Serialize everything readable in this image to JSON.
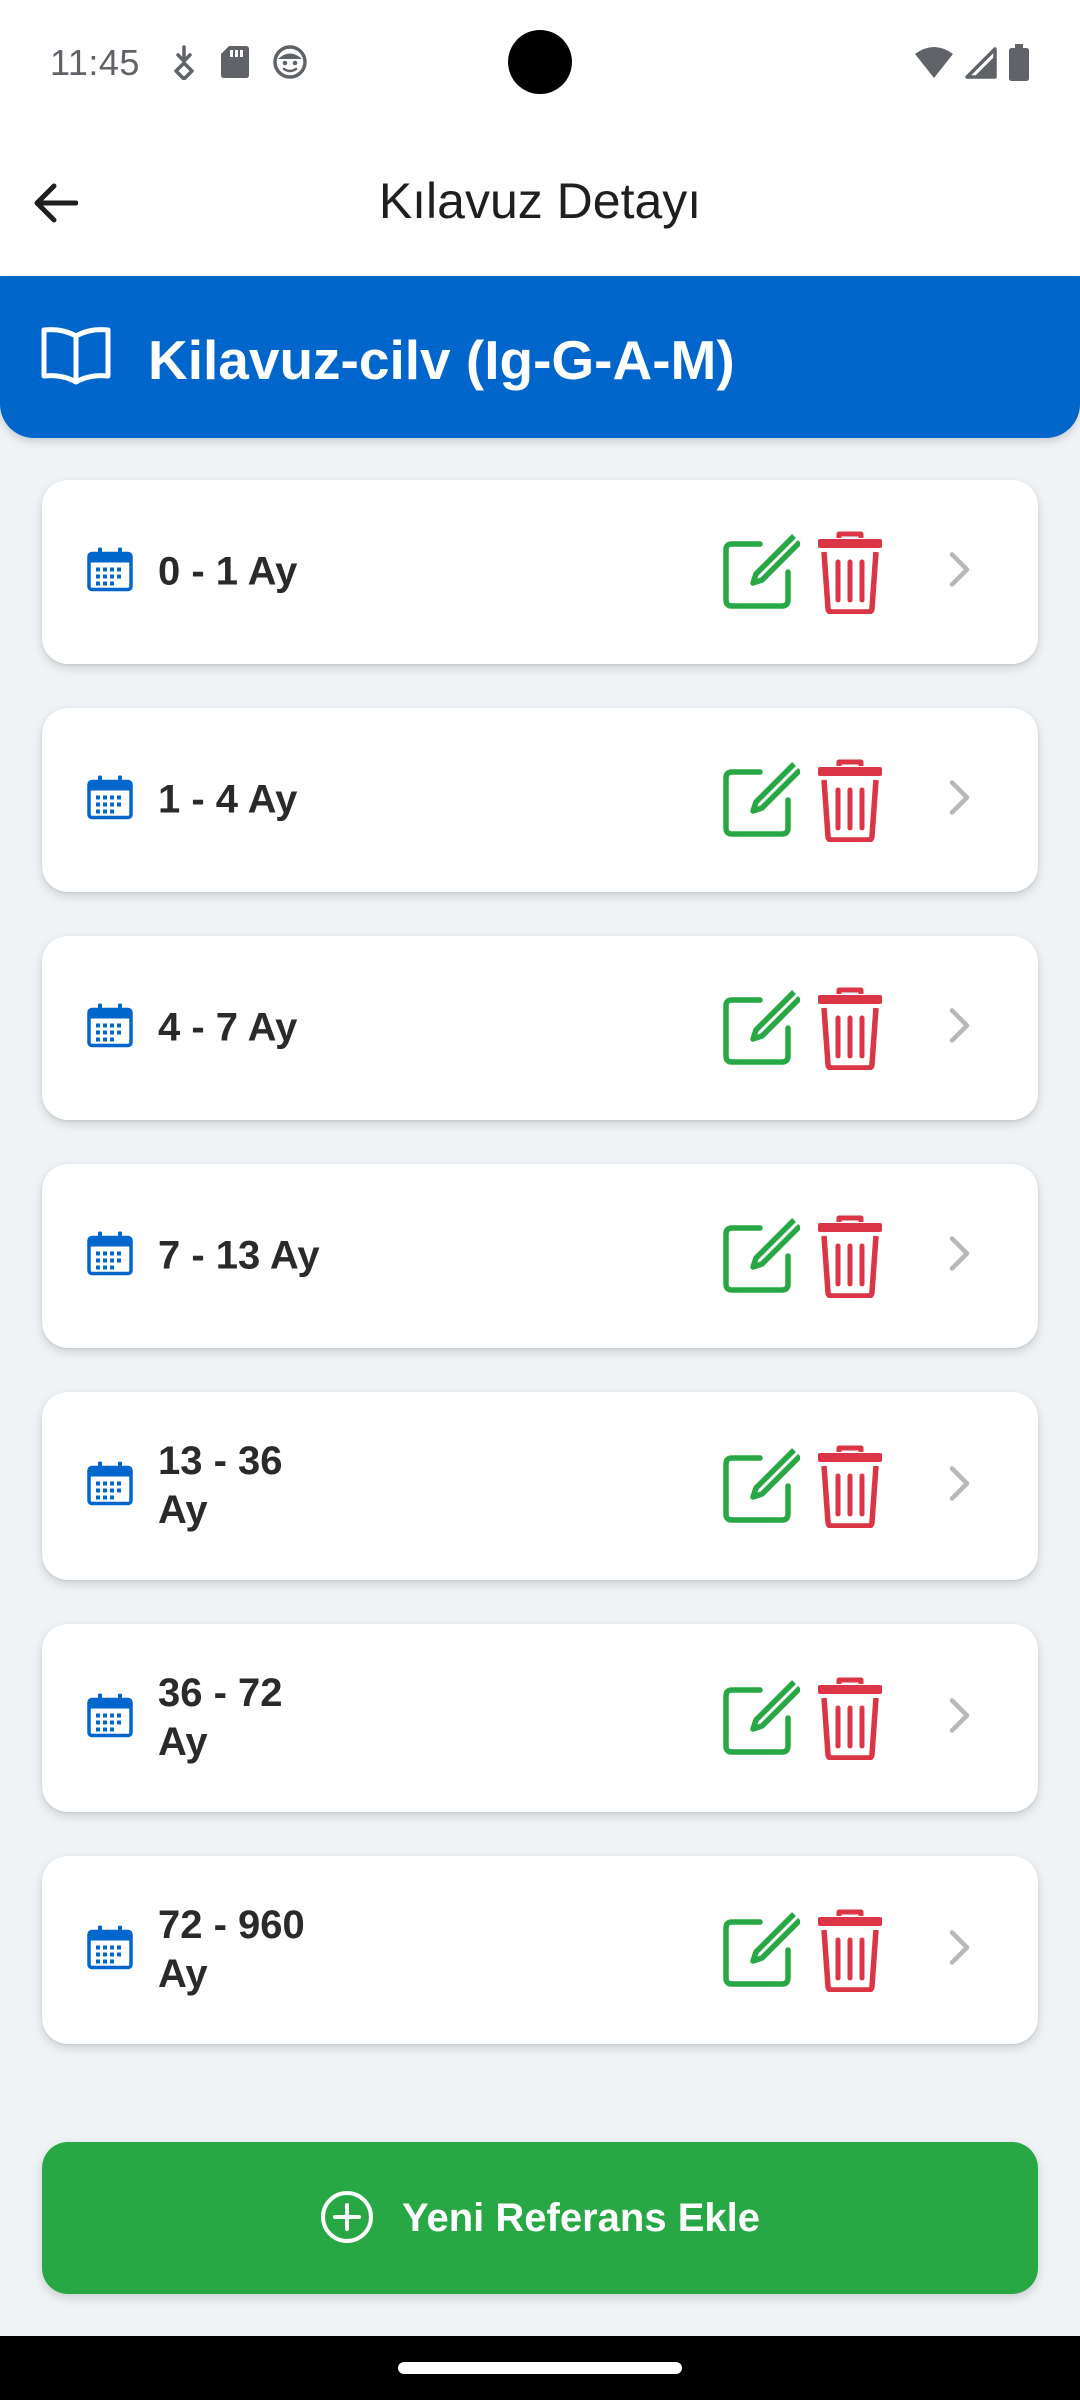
{
  "status_bar": {
    "time": "11:45"
  },
  "app_bar": {
    "title": "Kılavuz Detayı"
  },
  "guide": {
    "title": "Kilavuz-cilv (Ig-G-A-M)"
  },
  "references": [
    {
      "label": "0 - 1 Ay"
    },
    {
      "label": "1 - 4 Ay"
    },
    {
      "label": "4 - 7 Ay"
    },
    {
      "label": "7 - 13 Ay"
    },
    {
      "label": "13 - 36 Ay"
    },
    {
      "label": "36 - 72 Ay"
    },
    {
      "label": "72 - 960 Ay"
    }
  ],
  "actions": {
    "add_label": "Yeni Referans Ekle"
  },
  "colors": {
    "header_blue": "#0066cc",
    "edit_green": "#28a745",
    "delete_red": "#dc3545",
    "calendar_blue": "#0066cc",
    "add_button_green": "#28a745"
  }
}
